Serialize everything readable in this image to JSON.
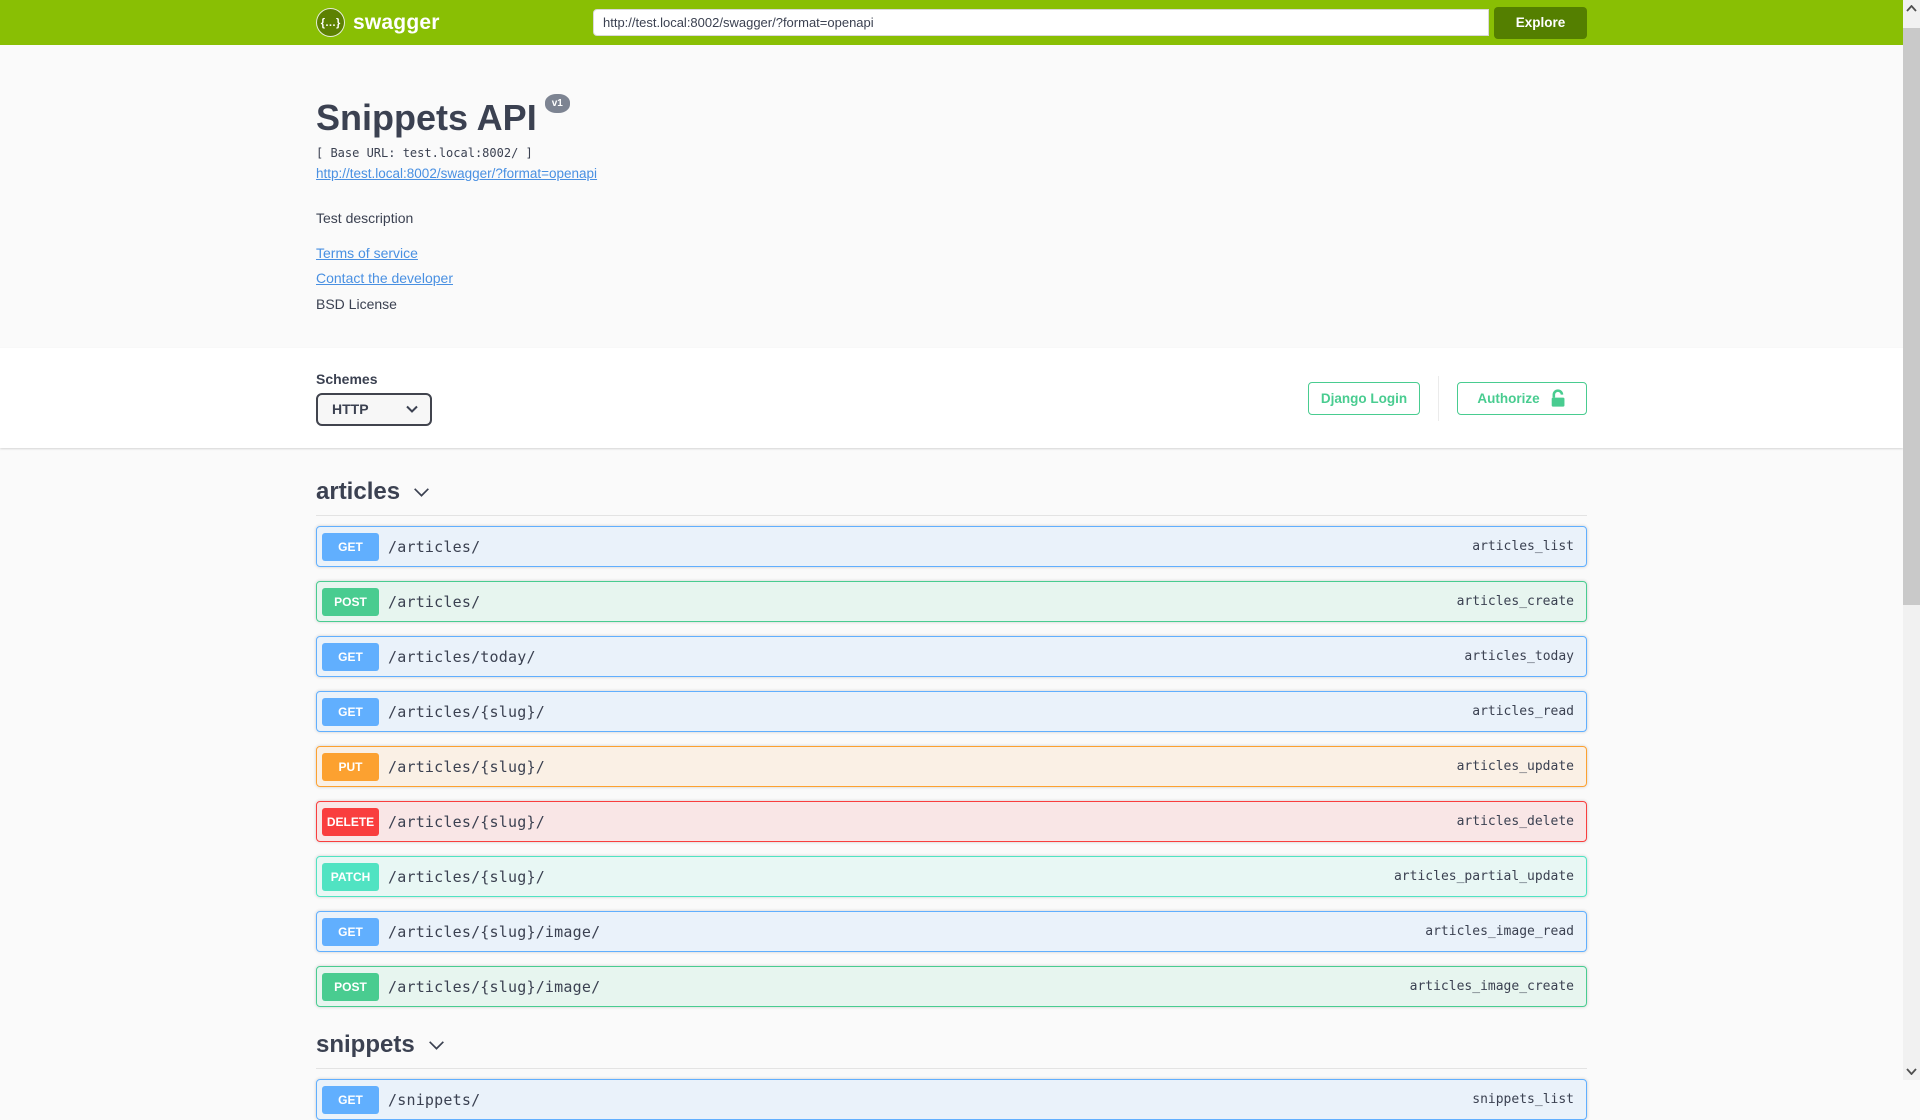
{
  "topbar": {
    "brand": "swagger",
    "logo_glyph": "{…}",
    "url_value": "http://test.local:8002/swagger/?format=openapi",
    "explore_label": "Explore"
  },
  "info": {
    "title": "Snippets API",
    "version_badge": "v1",
    "base_url_line": "[ Base URL: test.local:8002/ ]",
    "spec_link": "http://test.local:8002/swagger/?format=openapi",
    "description": "Test description",
    "terms_link": "Terms of service",
    "contact_link": "Contact the developer",
    "license_text": "BSD License"
  },
  "schemes": {
    "label": "Schemes",
    "selected": "HTTP"
  },
  "auth": {
    "django_login_label": "Django Login",
    "authorize_label": "Authorize"
  },
  "sections": [
    {
      "name": "articles",
      "operations": [
        {
          "method": "GET",
          "path": "/articles/",
          "operation_id": "articles_list"
        },
        {
          "method": "POST",
          "path": "/articles/",
          "operation_id": "articles_create"
        },
        {
          "method": "GET",
          "path": "/articles/today/",
          "operation_id": "articles_today"
        },
        {
          "method": "GET",
          "path": "/articles/{slug}/",
          "operation_id": "articles_read"
        },
        {
          "method": "PUT",
          "path": "/articles/{slug}/",
          "operation_id": "articles_update"
        },
        {
          "method": "DELETE",
          "path": "/articles/{slug}/",
          "operation_id": "articles_delete"
        },
        {
          "method": "PATCH",
          "path": "/articles/{slug}/",
          "operation_id": "articles_partial_update"
        },
        {
          "method": "GET",
          "path": "/articles/{slug}/image/",
          "operation_id": "articles_image_read"
        },
        {
          "method": "POST",
          "path": "/articles/{slug}/image/",
          "operation_id": "articles_image_create"
        }
      ]
    },
    {
      "name": "snippets",
      "operations": [
        {
          "method": "GET",
          "path": "/snippets/",
          "operation_id": "snippets_list"
        }
      ]
    }
  ],
  "colors": {
    "topbar_bg": "#89bf04",
    "explore_bg": "#547f00",
    "method_get": "#61affe",
    "method_post": "#49cc90",
    "method_put": "#fca130",
    "method_delete": "#f93e3e",
    "method_patch": "#50e3c2",
    "link_blue": "#4990e2",
    "text": "#3b4151",
    "version_badge_bg": "#7d8492",
    "auth_green": "#49cc90"
  }
}
